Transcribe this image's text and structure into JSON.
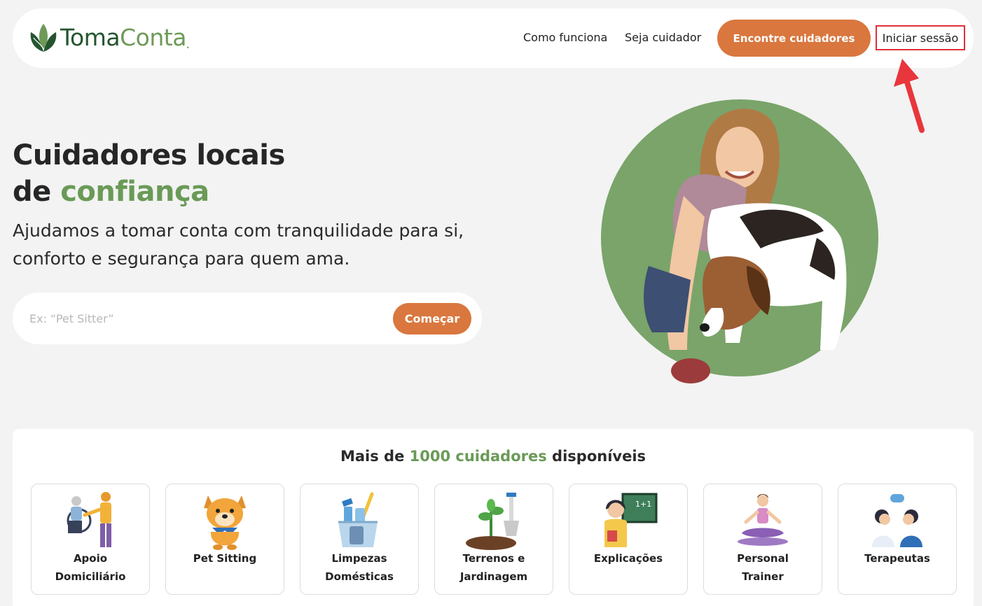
{
  "header": {
    "logo": {
      "part1": "Toma",
      "part2": "Conta"
    },
    "nav": {
      "como_funciona": "Como funciona",
      "seja_cuidador": "Seja cuidador",
      "encontre": "Encontre cuidadores",
      "login": "Iniciar sessão"
    }
  },
  "hero": {
    "title_line1": "Cuidadores locais",
    "title_line2_prefix": "de ",
    "title_line2_accent": "confiança",
    "subtitle": "Ajudamos a tomar conta com tranquilidade para si, conforto e segurança para quem ama.",
    "search": {
      "placeholder": "Ex: “Pet Sitter”",
      "button": "Começar"
    }
  },
  "categories": {
    "heading_prefix": "Mais de ",
    "heading_accent": "1000 cuidadores",
    "heading_suffix": " disponíveis",
    "items": [
      {
        "label_line1": "Apoio",
        "label_line2": "Domiciliário",
        "icon": "elderly-care-icon"
      },
      {
        "label_line1": "Pet Sitting",
        "label_line2": "",
        "icon": "dog-icon"
      },
      {
        "label_line1": "Limpezas",
        "label_line2": "Domésticas",
        "icon": "cleaning-bucket-icon"
      },
      {
        "label_line1": "Terrenos e",
        "label_line2": "Jardinagem",
        "icon": "plant-shovel-icon"
      },
      {
        "label_line1": "Explicações",
        "label_line2": "",
        "icon": "teacher-icon"
      },
      {
        "label_line1": "Personal",
        "label_line2": "Trainer",
        "icon": "yoga-icon"
      },
      {
        "label_line1": "Terapeutas",
        "label_line2": "",
        "icon": "therapy-icon"
      }
    ],
    "tile_board_text": "1+1"
  },
  "colors": {
    "accent_orange": "#d9773e",
    "brand_green": "#6a9a57",
    "brand_dark_green": "#24552f",
    "highlight_red": "#e0303a"
  }
}
